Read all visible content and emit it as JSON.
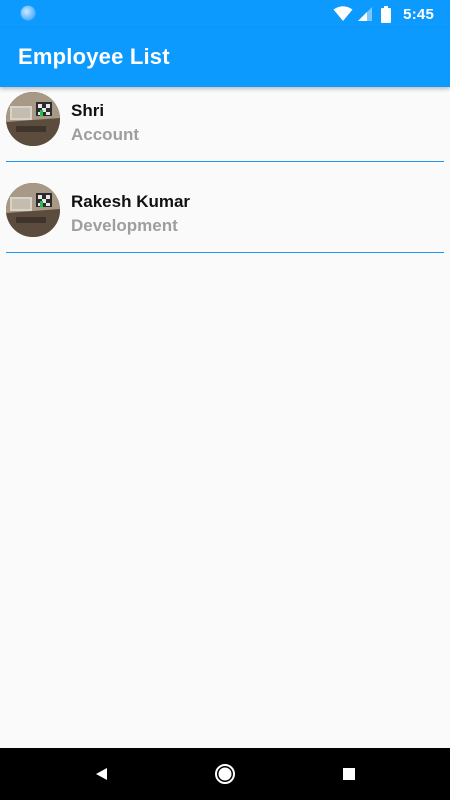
{
  "status_bar": {
    "time": "5:45",
    "icons": [
      "notification-dot-icon",
      "wifi-icon",
      "signal-icon",
      "battery-icon"
    ],
    "background": "#0d9aff"
  },
  "app_bar": {
    "title": "Employee List",
    "background": "#0d9aff"
  },
  "employees": [
    {
      "name": "Shri",
      "department": "Account",
      "avatar_icon": "employee-photo"
    },
    {
      "name": "Rakesh Kumar",
      "department": "Development",
      "avatar_icon": "employee-photo"
    }
  ],
  "colors": {
    "divider": "#2196f3",
    "name_text": "#111111",
    "department_text": "#9e9e9e",
    "background": "#fafafa"
  },
  "nav_bar": {
    "buttons": [
      "back-icon",
      "home-icon",
      "recents-icon"
    ]
  }
}
